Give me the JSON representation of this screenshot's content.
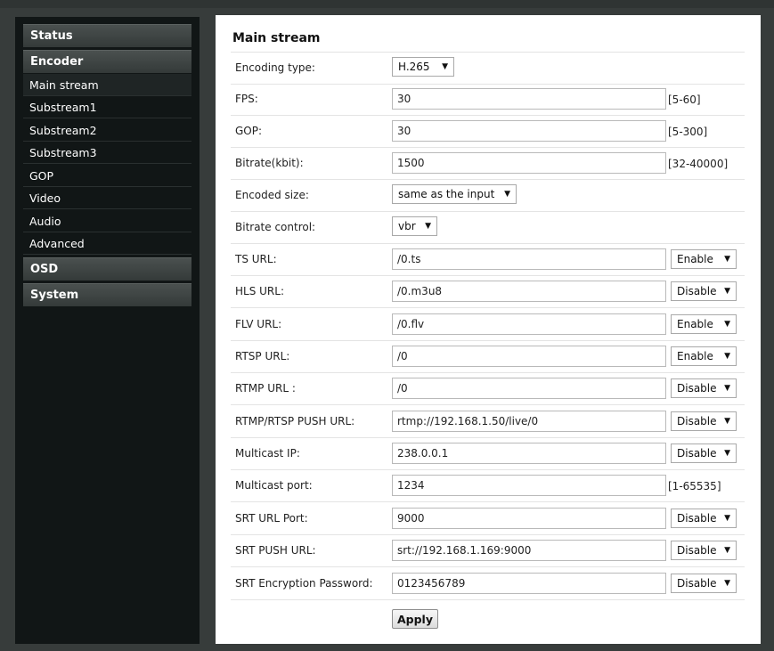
{
  "sidebar": {
    "status": "Status",
    "encoder": "Encoder",
    "items": [
      "Main stream",
      "Substream1",
      "Substream2",
      "Substream3",
      "GOP",
      "Video",
      "Audio",
      "Advanced"
    ],
    "osd": "OSD",
    "system": "System"
  },
  "main": {
    "title": "Main stream",
    "encoding_type": {
      "label": "Encoding type:",
      "value": "H.265"
    },
    "fps": {
      "label": "FPS:",
      "value": "30",
      "range": "[5-60]"
    },
    "gop": {
      "label": "GOP:",
      "value": "30",
      "range": "[5-300]"
    },
    "bitrate": {
      "label": "Bitrate(kbit):",
      "value": "1500",
      "range": "[32-40000]"
    },
    "encoded_size": {
      "label": "Encoded size:",
      "value": "same as the input"
    },
    "bitrate_control": {
      "label": "Bitrate control:",
      "value": "vbr"
    },
    "ts_url": {
      "label": "TS URL:",
      "value": "/0.ts",
      "state": "Enable"
    },
    "hls_url": {
      "label": "HLS URL:",
      "value": "/0.m3u8",
      "state": "Disable"
    },
    "flv_url": {
      "label": "FLV URL:",
      "value": "/0.flv",
      "state": "Enable"
    },
    "rtsp_url": {
      "label": "RTSP URL:",
      "value": "/0",
      "state": "Enable"
    },
    "rtmp_url": {
      "label": "RTMP URL :",
      "value": "/0",
      "state": "Disable"
    },
    "push_url": {
      "label": "RTMP/RTSP PUSH URL:",
      "value": "rtmp://192.168.1.50/live/0",
      "state": "Disable"
    },
    "multicast_ip": {
      "label": "Multicast IP:",
      "value": "238.0.0.1",
      "state": "Disable"
    },
    "multicast_port": {
      "label": "Multicast port:",
      "value": "1234",
      "range": "[1-65535]"
    },
    "srt_port": {
      "label": "SRT URL Port:",
      "value": "9000",
      "state": "Disable"
    },
    "srt_push": {
      "label": "SRT PUSH URL:",
      "value": "srt://192.168.1.169:9000",
      "state": "Disable"
    },
    "srt_password": {
      "label": "SRT Encryption Password:",
      "value": "0123456789",
      "state": "Disable"
    },
    "apply": "Apply"
  }
}
